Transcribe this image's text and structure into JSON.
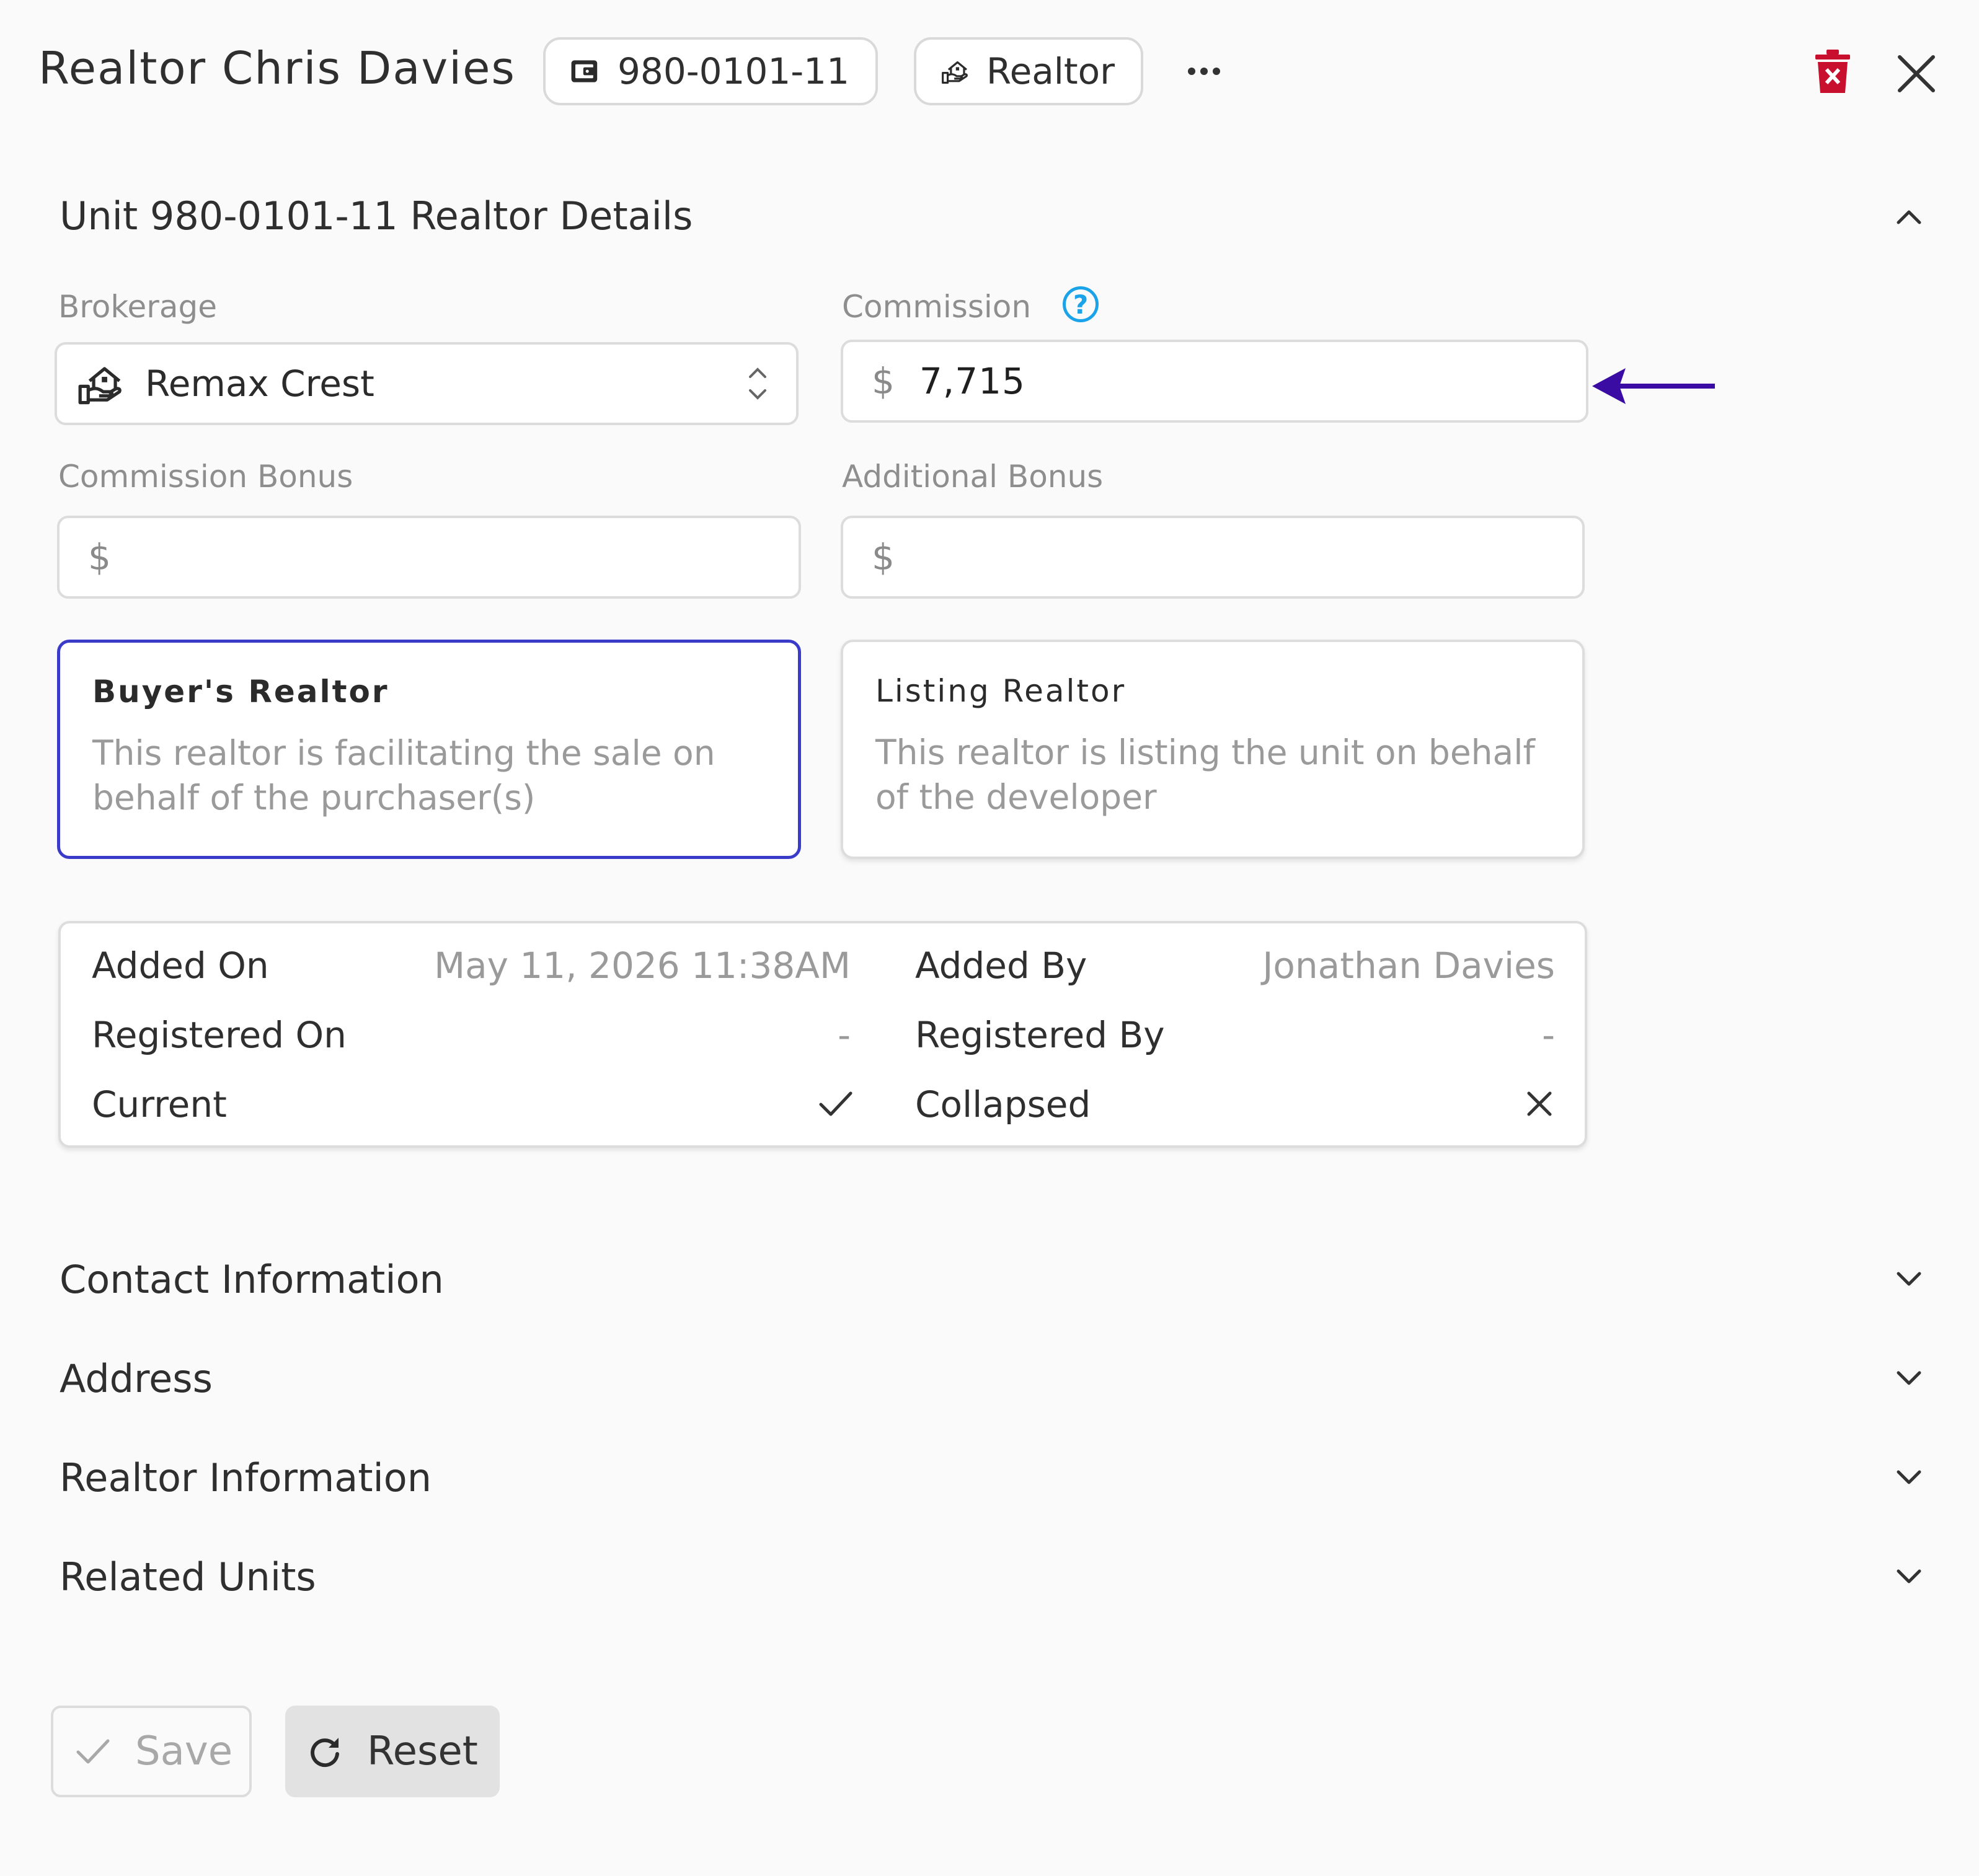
{
  "header": {
    "title": "Realtor Chris Davies",
    "unit_chip": "980-0101-11",
    "role_chip": "Realtor",
    "icons": {
      "unit": "wallet-icon",
      "role": "realtor-house-hand-icon",
      "more": "more-horizontal-icon",
      "delete": "trash-icon",
      "close": "close-icon"
    },
    "delete_color": "#c8102e"
  },
  "details": {
    "title": "Unit 980-0101-11 Realtor Details",
    "brokerage": {
      "label": "Brokerage",
      "value": "Remax Crest"
    },
    "commission": {
      "label": "Commission",
      "currency": "$",
      "value": "7,715"
    },
    "commission_bonus": {
      "label": "Commission Bonus",
      "currency": "$",
      "value": ""
    },
    "additional_bonus": {
      "label": "Additional Bonus",
      "currency": "$",
      "value": ""
    },
    "realtor_types": [
      {
        "title": "Buyer's Realtor",
        "description": "This realtor is facilitating the sale on behalf of the purchaser(s)",
        "selected": true
      },
      {
        "title": "Listing Realtor",
        "description": "This realtor is listing the unit on behalf of the developer",
        "selected": false
      }
    ],
    "meta": {
      "added_on": {
        "label": "Added On",
        "value": "May 11, 2026 11:38AM"
      },
      "added_by": {
        "label": "Added By",
        "value": "Jonathan Davies"
      },
      "registered_on": {
        "label": "Registered On",
        "value": "-"
      },
      "registered_by": {
        "label": "Registered By",
        "value": "-"
      },
      "current": {
        "label": "Current",
        "value": "check"
      },
      "collapsed": {
        "label": "Collapsed",
        "value": "x"
      }
    }
  },
  "sections": [
    "Contact Information",
    "Address",
    "Realtor Information",
    "Related Units"
  ],
  "actions": {
    "save": "Save",
    "reset": "Reset"
  },
  "colors": {
    "accent": "#3b3bc9",
    "arrow": "#3a0ca3",
    "help": "#1aa3e8"
  }
}
